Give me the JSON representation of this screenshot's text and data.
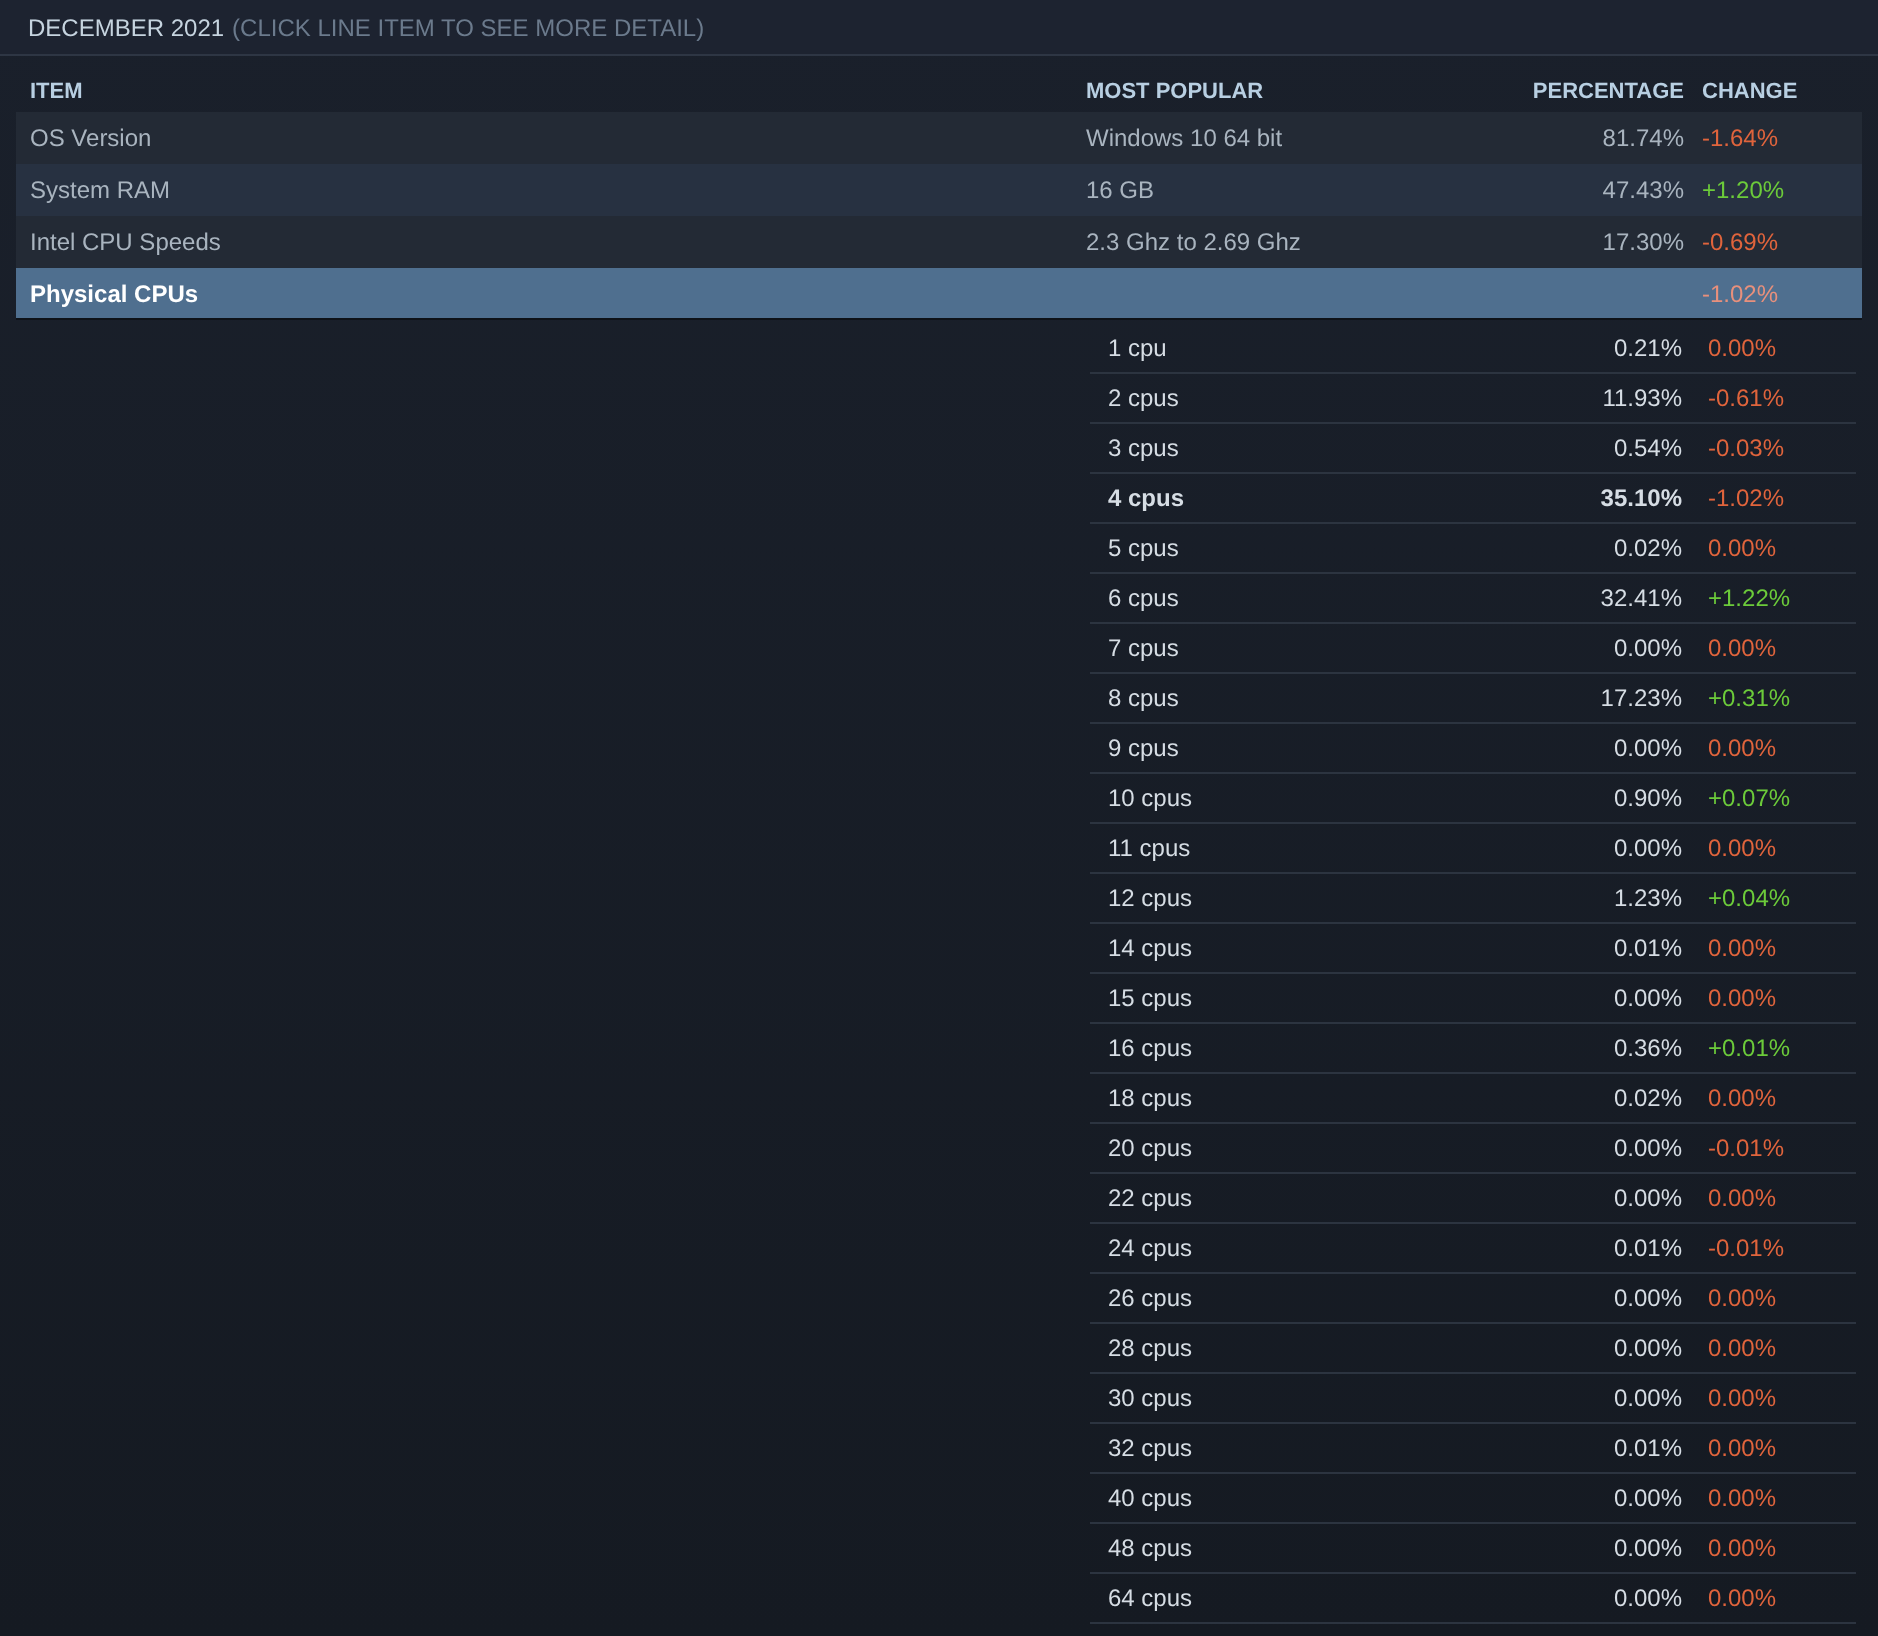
{
  "header": {
    "title": "DECEMBER 2021",
    "hint": "(CLICK LINE ITEM TO SEE MORE DETAIL)"
  },
  "columns": [
    "ITEM",
    "MOST POPULAR",
    "PERCENTAGE",
    "CHANGE"
  ],
  "rows": [
    {
      "item": "OS Version",
      "most_popular": "Windows 10 64 bit",
      "percentage": "81.74%",
      "change": "-1.64%",
      "color": "#e0643c",
      "selected": false
    },
    {
      "item": "System RAM",
      "most_popular": "16 GB",
      "percentage": "47.43%",
      "change": "+1.20%",
      "color": "#6ccb3a",
      "selected": false
    },
    {
      "item": "Intel CPU Speeds",
      "most_popular": "2.3 Ghz to 2.69 Ghz",
      "percentage": "17.30%",
      "change": "-0.69%",
      "color": "#e0643c",
      "selected": false
    },
    {
      "item": "Physical CPUs",
      "change": "-1.02%",
      "color": "#e8907c",
      "selected": true
    }
  ],
  "details": [
    {
      "label": "1 cpu",
      "percentage": "0.21%",
      "change": "0.00%",
      "color": "#e0643c",
      "highlighted": false
    },
    {
      "label": "2 cpus",
      "percentage": "11.93%",
      "change": "-0.61%",
      "color": "#e0643c",
      "highlighted": false
    },
    {
      "label": "3 cpus",
      "percentage": "0.54%",
      "change": "-0.03%",
      "color": "#e0643c",
      "highlighted": false
    },
    {
      "label": "4 cpus",
      "percentage": "35.10%",
      "change": "-1.02%",
      "color": "#e0643c",
      "highlighted": true
    },
    {
      "label": "5 cpus",
      "percentage": "0.02%",
      "change": "0.00%",
      "color": "#e0643c",
      "highlighted": false
    },
    {
      "label": "6 cpus",
      "percentage": "32.41%",
      "change": "+1.22%",
      "color": "#6ccb3a",
      "highlighted": false
    },
    {
      "label": "7 cpus",
      "percentage": "0.00%",
      "change": "0.00%",
      "color": "#e0643c",
      "highlighted": false
    },
    {
      "label": "8 cpus",
      "percentage": "17.23%",
      "change": "+0.31%",
      "color": "#6ccb3a",
      "highlighted": false
    },
    {
      "label": "9 cpus",
      "percentage": "0.00%",
      "change": "0.00%",
      "color": "#e0643c",
      "highlighted": false
    },
    {
      "label": "10 cpus",
      "percentage": "0.90%",
      "change": "+0.07%",
      "color": "#6ccb3a",
      "highlighted": false
    },
    {
      "label": "11 cpus",
      "percentage": "0.00%",
      "change": "0.00%",
      "color": "#e0643c",
      "highlighted": false
    },
    {
      "label": "12 cpus",
      "percentage": "1.23%",
      "change": "+0.04%",
      "color": "#6ccb3a",
      "highlighted": false
    },
    {
      "label": "14 cpus",
      "percentage": "0.01%",
      "change": "0.00%",
      "color": "#e0643c",
      "highlighted": false
    },
    {
      "label": "15 cpus",
      "percentage": "0.00%",
      "change": "0.00%",
      "color": "#e0643c",
      "highlighted": false
    },
    {
      "label": "16 cpus",
      "percentage": "0.36%",
      "change": "+0.01%",
      "color": "#6ccb3a",
      "highlighted": false
    },
    {
      "label": "18 cpus",
      "percentage": "0.02%",
      "change": "0.00%",
      "color": "#e0643c",
      "highlighted": false
    },
    {
      "label": "20 cpus",
      "percentage": "0.00%",
      "change": "-0.01%",
      "color": "#e0643c",
      "highlighted": false
    },
    {
      "label": "22 cpus",
      "percentage": "0.00%",
      "change": "0.00%",
      "color": "#e0643c",
      "highlighted": false
    },
    {
      "label": "24 cpus",
      "percentage": "0.01%",
      "change": "-0.01%",
      "color": "#e0643c",
      "highlighted": false
    },
    {
      "label": "26 cpus",
      "percentage": "0.00%",
      "change": "0.00%",
      "color": "#e0643c",
      "highlighted": false
    },
    {
      "label": "28 cpus",
      "percentage": "0.00%",
      "change": "0.00%",
      "color": "#e0643c",
      "highlighted": false
    },
    {
      "label": "30 cpus",
      "percentage": "0.00%",
      "change": "0.00%",
      "color": "#e0643c",
      "highlighted": false
    },
    {
      "label": "32 cpus",
      "percentage": "0.01%",
      "change": "0.00%",
      "color": "#e0643c",
      "highlighted": false
    },
    {
      "label": "40 cpus",
      "percentage": "0.00%",
      "change": "0.00%",
      "color": "#e0643c",
      "highlighted": false
    },
    {
      "label": "48 cpus",
      "percentage": "0.00%",
      "change": "0.00%",
      "color": "#e0643c",
      "highlighted": false
    },
    {
      "label": "64 cpus",
      "percentage": "0.00%",
      "change": "0.00%",
      "color": "#e0643c",
      "highlighted": false
    }
  ]
}
